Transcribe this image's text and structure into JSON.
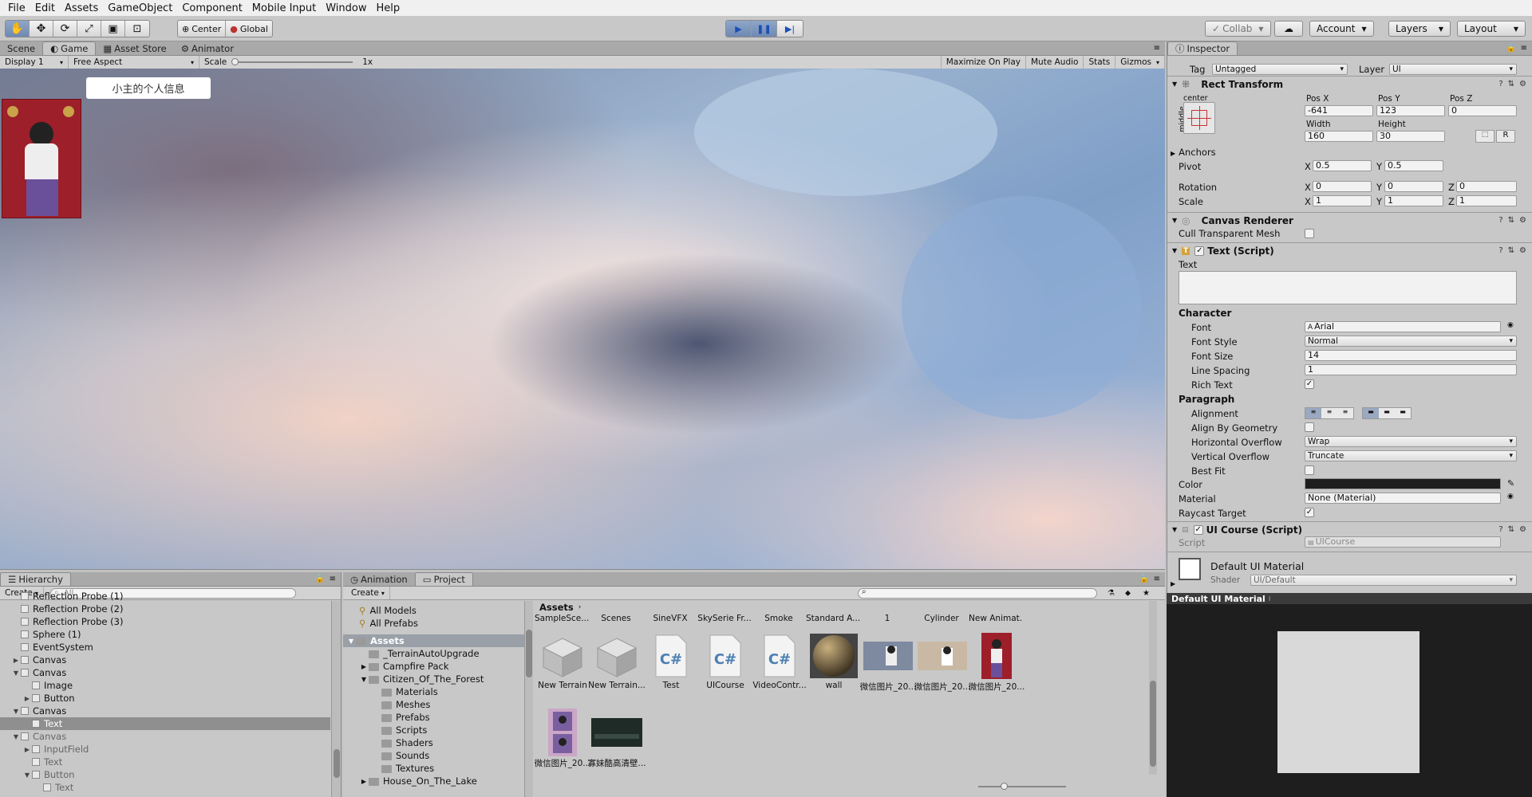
{
  "menu": [
    "File",
    "Edit",
    "Assets",
    "GameObject",
    "Component",
    "Mobile Input",
    "Window",
    "Help"
  ],
  "toolbar": {
    "tools": [
      "hand-icon",
      "move-icon",
      "rotate-icon",
      "scale-icon",
      "rect-icon",
      "transform-icon"
    ],
    "pivot": "Center",
    "space": "Global",
    "collab": "Collab",
    "account": "Account",
    "layers": "Layers",
    "layout": "Layout"
  },
  "scene_tabs": [
    "Scene",
    "Game",
    "Asset Store",
    "Animator"
  ],
  "game_bar": {
    "display": "Display 1",
    "aspect": "Free Aspect",
    "scale_label": "Scale",
    "scale_value": "1x",
    "buttons": [
      "Maximize On Play",
      "Mute Audio",
      "Stats",
      "Gizmos"
    ]
  },
  "game_ui": {
    "button_text": "小主的个人信息"
  },
  "hierarchy": {
    "title": "Hierarchy",
    "create": "Create",
    "search_placeholder": "All",
    "rows": [
      {
        "label": "Reflection Probe (1)",
        "indent": 0,
        "arrow": "",
        "sel": false,
        "dim": false
      },
      {
        "label": "Reflection Probe (2)",
        "indent": 0,
        "arrow": "",
        "sel": false,
        "dim": false
      },
      {
        "label": "Reflection Probe (3)",
        "indent": 0,
        "arrow": "",
        "sel": false,
        "dim": false
      },
      {
        "label": "Sphere (1)",
        "indent": 0,
        "arrow": "",
        "sel": false,
        "dim": false
      },
      {
        "label": "EventSystem",
        "indent": 0,
        "arrow": "",
        "sel": false,
        "dim": false
      },
      {
        "label": "Canvas",
        "indent": 0,
        "arrow": "▶",
        "sel": false,
        "dim": false
      },
      {
        "label": "Canvas",
        "indent": 0,
        "arrow": "▼",
        "sel": false,
        "dim": false
      },
      {
        "label": "Image",
        "indent": 1,
        "arrow": "",
        "sel": false,
        "dim": false
      },
      {
        "label": "Button",
        "indent": 1,
        "arrow": "▶",
        "sel": false,
        "dim": false
      },
      {
        "label": "Canvas",
        "indent": 0,
        "arrow": "▼",
        "sel": false,
        "dim": false
      },
      {
        "label": "Text",
        "indent": 1,
        "arrow": "",
        "sel": true,
        "dim": false
      },
      {
        "label": "Canvas",
        "indent": 0,
        "arrow": "▼",
        "sel": false,
        "dim": true
      },
      {
        "label": "InputField",
        "indent": 1,
        "arrow": "▶",
        "sel": false,
        "dim": true
      },
      {
        "label": "Text",
        "indent": 1,
        "arrow": "",
        "sel": false,
        "dim": true
      },
      {
        "label": "Button",
        "indent": 1,
        "arrow": "▼",
        "sel": false,
        "dim": true
      },
      {
        "label": "Text",
        "indent": 2,
        "arrow": "",
        "sel": false,
        "dim": true
      }
    ]
  },
  "project": {
    "tabs": [
      "Animation",
      "Project"
    ],
    "create": "Create",
    "favorites": [
      "All Models",
      "All Prefabs"
    ],
    "tree": [
      {
        "label": "Assets",
        "indent": 0,
        "arrow": "▼",
        "bold": true
      },
      {
        "label": "_TerrainAutoUpgrade",
        "indent": 1,
        "arrow": "",
        "bold": false
      },
      {
        "label": "Campfire Pack",
        "indent": 1,
        "arrow": "▶",
        "bold": false
      },
      {
        "label": "Citizen_Of_The_Forest",
        "indent": 1,
        "arrow": "▼",
        "bold": false
      },
      {
        "label": "Materials",
        "indent": 2,
        "arrow": "",
        "bold": false
      },
      {
        "label": "Meshes",
        "indent": 2,
        "arrow": "",
        "bold": false
      },
      {
        "label": "Prefabs",
        "indent": 2,
        "arrow": "",
        "bold": false
      },
      {
        "label": "Scripts",
        "indent": 2,
        "arrow": "",
        "bold": false
      },
      {
        "label": "Shaders",
        "indent": 2,
        "arrow": "",
        "bold": false
      },
      {
        "label": "Sounds",
        "indent": 2,
        "arrow": "",
        "bold": false
      },
      {
        "label": "Textures",
        "indent": 2,
        "arrow": "",
        "bold": false
      },
      {
        "label": "House_On_The_Lake",
        "indent": 1,
        "arrow": "▶",
        "bold": false
      }
    ],
    "breadcrumb": "Assets",
    "folder_row": [
      "SampleSce...",
      "Scenes",
      "SineVFX",
      "SkySerie Fr...",
      "Smoke",
      "Standard A...",
      "1",
      "Cylinder",
      "New Animat..."
    ],
    "assets_row1": [
      {
        "label": "New Terrain",
        "kind": "prefab"
      },
      {
        "label": "New Terrain...",
        "kind": "prefab"
      },
      {
        "label": "Test",
        "kind": "cs"
      },
      {
        "label": "UICourse",
        "kind": "cs"
      },
      {
        "label": "VideoContr...",
        "kind": "cs"
      },
      {
        "label": "wall",
        "kind": "sphere"
      },
      {
        "label": "微信图片_20...",
        "kind": "photo-wide"
      },
      {
        "label": "微信图片_20...",
        "kind": "photo-wide2"
      },
      {
        "label": "微信图片_20...",
        "kind": "photo-tall"
      }
    ],
    "assets_row2": [
      {
        "label": "微信图片_20...",
        "kind": "photo-tall2"
      },
      {
        "label": "寡妹酷高清壁...",
        "kind": "dark"
      }
    ]
  },
  "inspector": {
    "title": "Inspector",
    "tag_label": "Tag",
    "tag_value": "Untagged",
    "layer_label": "Layer",
    "layer_value": "UI",
    "rect": {
      "title": "Rect Transform",
      "anchor_h": "center",
      "anchor_v": "middle",
      "pos_x_label": "Pos X",
      "pos_y_label": "Pos Y",
      "pos_z_label": "Pos Z",
      "pos_x": "-641",
      "pos_y": "123",
      "pos_z": "0",
      "width_label": "Width",
      "height_label": "Height",
      "width": "160",
      "height": "30",
      "r_button": "R",
      "anchors": "Anchors",
      "pivot_label": "Pivot",
      "pivot_x": "0.5",
      "pivot_y": "0.5",
      "rotation_label": "Rotation",
      "rot_x": "0",
      "rot_y": "0",
      "rot_z": "0",
      "scale_label": "Scale",
      "scale_x": "1",
      "scale_y": "1",
      "scale_z": "1",
      "x": "X",
      "y": "Y",
      "z": "Z"
    },
    "canvas_renderer": {
      "title": "Canvas Renderer",
      "cull_label": "Cull Transparent Mesh"
    },
    "text_script": {
      "title": "Text (Script)",
      "text_label": "Text",
      "character": "Character",
      "font_label": "Font",
      "font_value": "Arial",
      "font_style_label": "Font Style",
      "font_style_value": "Normal",
      "font_size_label": "Font Size",
      "font_size_value": "14",
      "line_spacing_label": "Line Spacing",
      "line_spacing_value": "1",
      "rich_text_label": "Rich Text",
      "paragraph": "Paragraph",
      "alignment_label": "Alignment",
      "align_geom_label": "Align By Geometry",
      "h_overflow_label": "Horizontal Overflow",
      "h_overflow_value": "Wrap",
      "v_overflow_label": "Vertical Overflow",
      "v_overflow_value": "Truncate",
      "best_fit_label": "Best Fit",
      "color_label": "Color",
      "color_value": "#1e1e1e",
      "material_label": "Material",
      "material_value": "None (Material)",
      "raycast_label": "Raycast Target"
    },
    "ui_course": {
      "title": "UI Course (Script)",
      "script_label": "Script",
      "script_value": "UICourse"
    },
    "material": {
      "name": "Default UI Material",
      "shader_label": "Shader",
      "shader_value": "UI/Default"
    },
    "preview_title": "Default UI Material"
  }
}
